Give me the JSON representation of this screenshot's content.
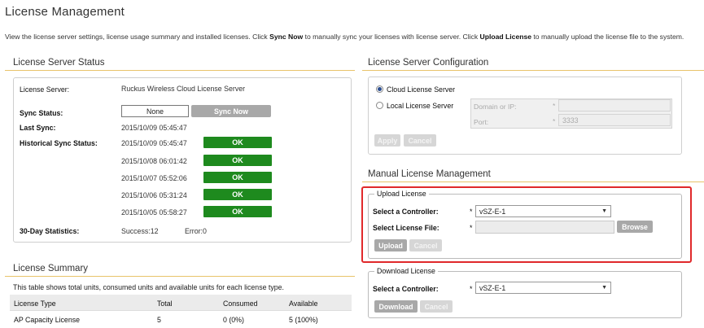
{
  "page": {
    "title": "License Management",
    "intro_part1": "View the license server settings, license usage summary and installed licenses. Click ",
    "intro_sync": "Sync Now",
    "intro_part2": " to manually sync your licenses with license server. Click ",
    "intro_upload": "Upload License",
    "intro_part3": " to manually upload the license file to the system."
  },
  "status": {
    "section_title": "License Server Status",
    "license_server_label": "License Server:",
    "license_server_value": "Ruckus Wireless Cloud License Server",
    "sync_status_label": "Sync Status:",
    "sync_status_value": "None",
    "sync_now_label": "Sync Now",
    "last_sync_label": "Last Sync:",
    "last_sync_value": "2015/10/09 05:45:47",
    "historical_label": "Historical Sync Status:",
    "history": [
      {
        "time": "2015/10/09 05:45:47",
        "result": "OK"
      },
      {
        "time": "2015/10/08 06:01:42",
        "result": "OK"
      },
      {
        "time": "2015/10/07 05:52:06",
        "result": "OK"
      },
      {
        "time": "2015/10/06 05:31:24",
        "result": "OK"
      },
      {
        "time": "2015/10/05 05:58:27",
        "result": "OK"
      }
    ],
    "stats_label": "30-Day Statistics:",
    "stats_success": "Success:12",
    "stats_error": "Error:0"
  },
  "summary": {
    "section_title": "License Summary",
    "description": "This table shows total units, consumed units and available units for each license type.",
    "columns": [
      "License Type",
      "Total",
      "Consumed",
      "Available"
    ],
    "rows": [
      [
        "AP Capacity License",
        "5",
        "0 (0%)",
        "5 (100%)"
      ]
    ]
  },
  "config": {
    "section_title": "License Server Configuration",
    "cloud_label": "Cloud License Server",
    "local_label": "Local License Server",
    "domain_label": "Domain or IP:",
    "port_label": "Port:",
    "port_value": "3333",
    "required_mark": "*",
    "apply_label": "Apply",
    "cancel_label": "Cancel"
  },
  "manual": {
    "section_title": "Manual License Management",
    "upload": {
      "legend": "Upload License",
      "controller_label": "Select a Controller:",
      "controller_value": "vSZ-E-1",
      "file_label": "Select License File:",
      "file_value": "",
      "browse_label": "Browse",
      "upload_label": "Upload",
      "cancel_label": "Cancel",
      "required_mark": "*"
    },
    "download": {
      "legend": "Download License",
      "controller_label": "Select a Controller:",
      "controller_value": "vSZ-E-1",
      "download_label": "Download",
      "cancel_label": "Cancel",
      "required_mark": "*"
    }
  },
  "colors": {
    "ok_green": "#1e8a1e",
    "section_rule": "#e8c36a",
    "highlight_red": "#e0292b"
  }
}
